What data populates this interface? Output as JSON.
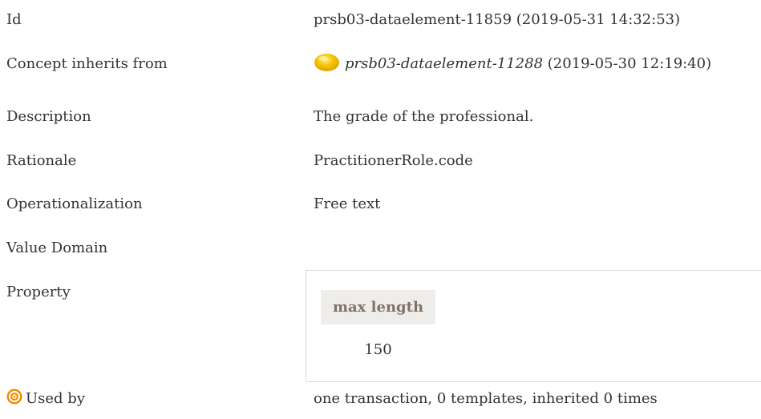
{
  "rows": {
    "id": {
      "label": "Id",
      "value": "prsb03-dataelement-11859 (2019-05-31 14:32:53)"
    },
    "inherits": {
      "label": "Concept inherits from",
      "ref_id": "prsb03-dataelement-11288",
      "ref_date": " (2019-05-30 12:19:40)",
      "icon": "yellow-circle-icon"
    },
    "description": {
      "label": "Description",
      "value": "The grade of the professional."
    },
    "rationale": {
      "label": "Rationale",
      "value": "PractitionerRole.code"
    },
    "operationalization": {
      "label": "Operationalization",
      "value": "Free text"
    },
    "value_domain": {
      "label": "Value Domain"
    },
    "property": {
      "label": "Property",
      "header": "max length",
      "value": "150"
    },
    "used_by": {
      "label": "Used by",
      "value": "one transaction, 0 templates, inherited 0 times",
      "icon": "target-icon"
    }
  },
  "colors": {
    "text": "#333333",
    "prop_header_bg": "#efedea",
    "prop_header_text": "#7f7266",
    "icon_yellow": "#f5c400",
    "icon_orange": "#f28c00"
  }
}
